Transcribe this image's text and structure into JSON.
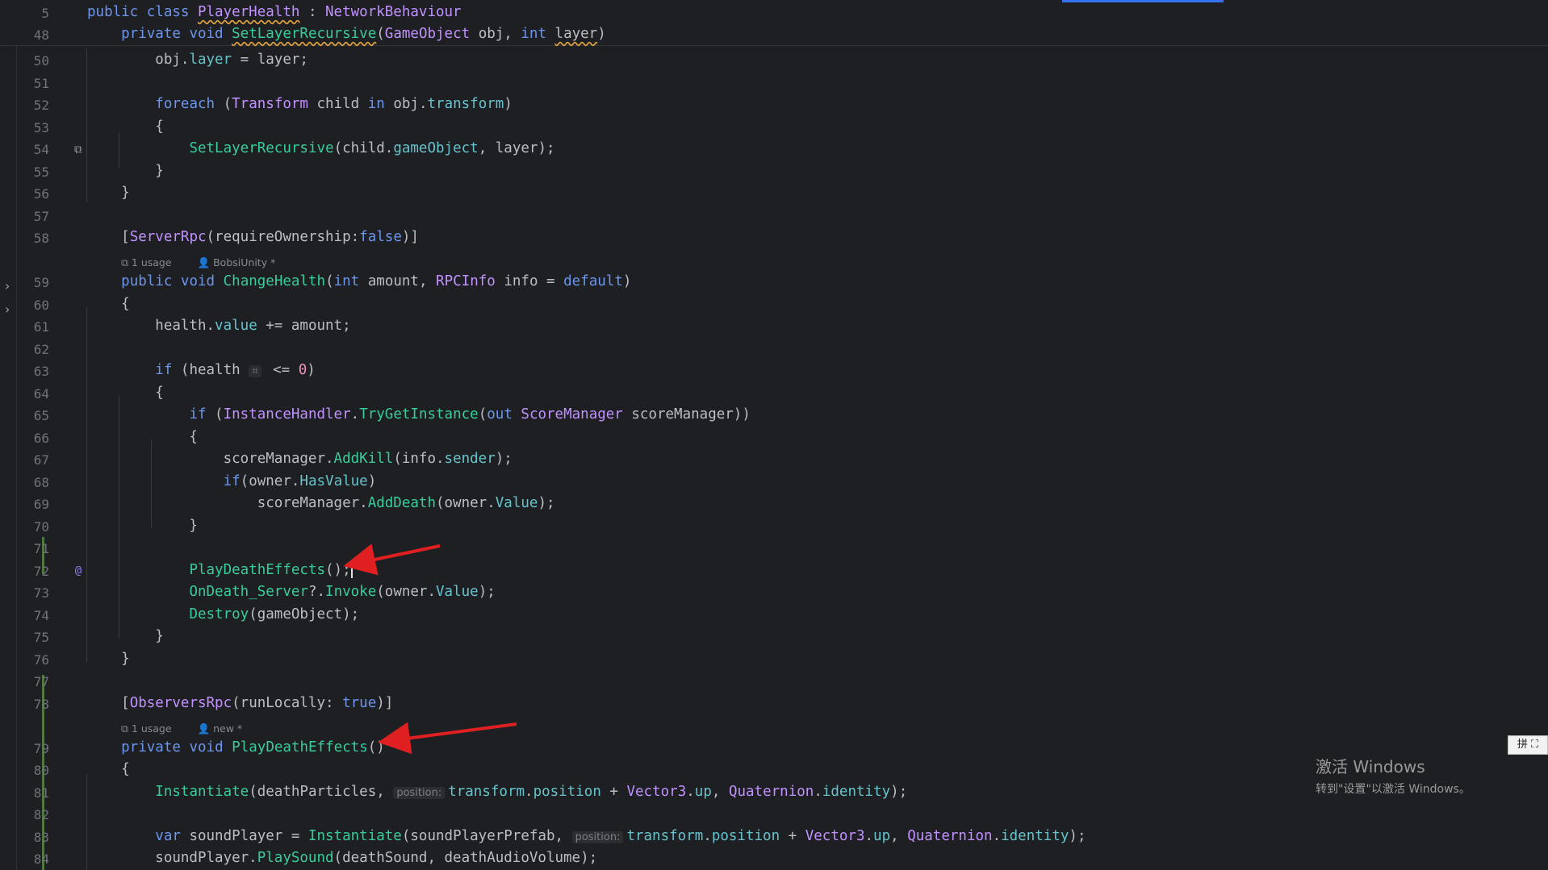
{
  "editor": {
    "header_lines": [
      {
        "num": "5",
        "code": "public class PlayerHealth : NetworkBehaviour"
      },
      {
        "num": "48",
        "code": "    private void SetLayerRecursive(GameObject obj, int layer)"
      }
    ],
    "lines": [
      {
        "num": "50",
        "code": "        obj.layer = layer;"
      },
      {
        "num": "51",
        "code": ""
      },
      {
        "num": "52",
        "code": "        foreach (Transform child in obj.transform)"
      },
      {
        "num": "53",
        "code": "        {"
      },
      {
        "num": "54",
        "code": "            SetLayerRecursive(child.gameObject, layer);"
      },
      {
        "num": "55",
        "code": "        }"
      },
      {
        "num": "56",
        "code": "    }"
      },
      {
        "num": "57",
        "code": ""
      },
      {
        "num": "58",
        "code": "    [ServerRpc(requireOwnership:false)]"
      },
      {
        "num": "59",
        "code": "    public void ChangeHealth(int amount, RPCInfo info = default)"
      },
      {
        "num": "60",
        "code": "    {"
      },
      {
        "num": "61",
        "code": "        health.value += amount;"
      },
      {
        "num": "62",
        "code": ""
      },
      {
        "num": "63",
        "code": "        if (health  <= 0)"
      },
      {
        "num": "64",
        "code": "        {"
      },
      {
        "num": "65",
        "code": "            if (InstanceHandler.TryGetInstance(out ScoreManager scoreManager))"
      },
      {
        "num": "66",
        "code": "            {"
      },
      {
        "num": "67",
        "code": "                scoreManager.AddKill(info.sender);"
      },
      {
        "num": "68",
        "code": "                if(owner.HasValue)"
      },
      {
        "num": "69",
        "code": "                    scoreManager.AddDeath(owner.Value);"
      },
      {
        "num": "70",
        "code": "            }"
      },
      {
        "num": "71",
        "code": ""
      },
      {
        "num": "72",
        "code": "            PlayDeathEffects();"
      },
      {
        "num": "73",
        "code": "            OnDeath_Server?.Invoke(owner.Value);"
      },
      {
        "num": "74",
        "code": "            Destroy(gameObject);"
      },
      {
        "num": "75",
        "code": "        }"
      },
      {
        "num": "76",
        "code": "    }"
      },
      {
        "num": "77",
        "code": ""
      },
      {
        "num": "78",
        "code": "    [ObserversRpc(runLocally: true)]"
      },
      {
        "num": "79",
        "code": "    private void PlayDeathEffects()"
      },
      {
        "num": "80",
        "code": "    {"
      },
      {
        "num": "81",
        "code": "        Instantiate(deathParticles, transform.position + Vector3.up, Quaternion.identity);"
      },
      {
        "num": "82",
        "code": ""
      },
      {
        "num": "83",
        "code": "        var soundPlayer = Instantiate(soundPlayerPrefab, transform.position + Vector3.up, Quaternion.identity);"
      },
      {
        "num": "84",
        "code": "        soundPlayer.PlaySound(deathSound, deathAudioVolume);"
      }
    ],
    "code_lens": [
      {
        "usage": "1 usage",
        "author": "BobsiUnity *"
      },
      {
        "usage": "1 usage",
        "author": "new *"
      }
    ],
    "inlay_hints": {
      "position": "position:"
    }
  },
  "annotation_color": "#e02020",
  "watermark": {
    "title": "激活 Windows",
    "subtitle": "转到\"设置\"以激活 Windows。"
  },
  "ime_indicator": "拼 ⛶"
}
